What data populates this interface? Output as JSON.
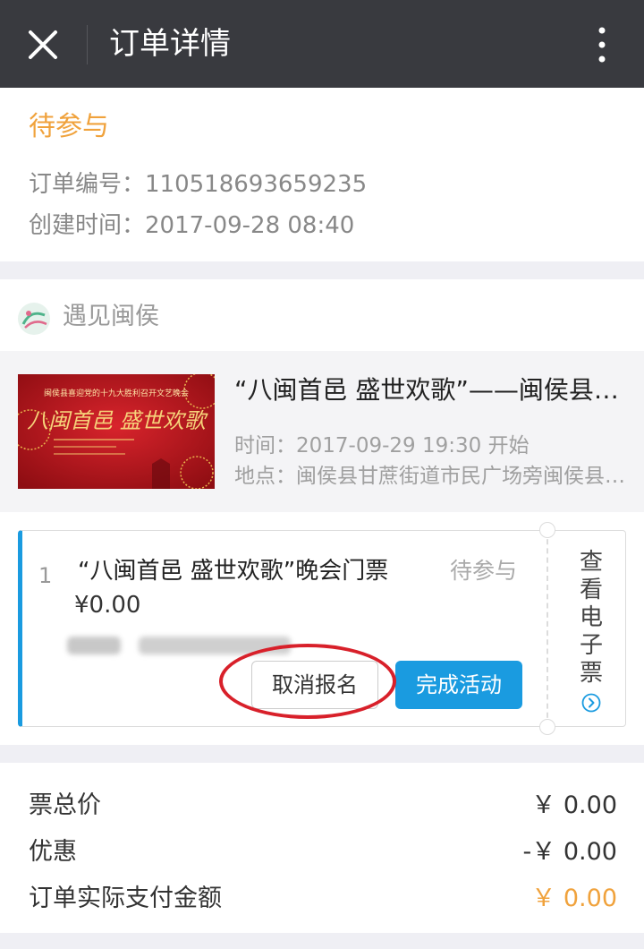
{
  "nav": {
    "title": "订单详情"
  },
  "order": {
    "status": "待参与",
    "number_label": "订单编号：",
    "number": "110518693659235",
    "created_label": "创建时间：",
    "created": "2017-09-28 08:40"
  },
  "organizer": {
    "name": "遇见闽侯"
  },
  "event": {
    "title": "“八闽首邑 盛世欢歌”——闽侯县喜迎党的十九大胜利召开文艺晚会",
    "time_label": "时间：",
    "time": "2017-09-29 19:30 开始",
    "place_label": "地点：",
    "place": "闽侯县甘蔗街道市民广场旁闽侯县文化中心",
    "poster": {
      "heading": "闽侯县喜迎党的十九大胜利召开文艺晚会",
      "title": "八闽首邑  盛世欢歌"
    }
  },
  "ticket": {
    "index": "1",
    "name": "“八闽首邑 盛世欢歌”晚会门票",
    "status": "待参与",
    "price": "¥0.00",
    "cancel_label": "取消报名",
    "complete_label": "完成活动",
    "view_label": "查看电子票"
  },
  "summary": {
    "rows": [
      {
        "label": "票总价",
        "value": "￥ 0.00"
      },
      {
        "label": "优惠",
        "value": "-￥ 0.00"
      },
      {
        "label": "订单实际支付金额",
        "value": "￥ 0.00"
      }
    ]
  },
  "colors": {
    "nav_bg": "#393a3f",
    "status_orange": "#f0a23c",
    "accent_blue": "#1a9be0",
    "annotation_red": "#d8202a"
  },
  "icons": {
    "close": "close-icon",
    "more": "more-vertical-icon",
    "organizer_logo": "organizer-logo-icon",
    "view_arrow": "chevron-right-circle-icon"
  }
}
